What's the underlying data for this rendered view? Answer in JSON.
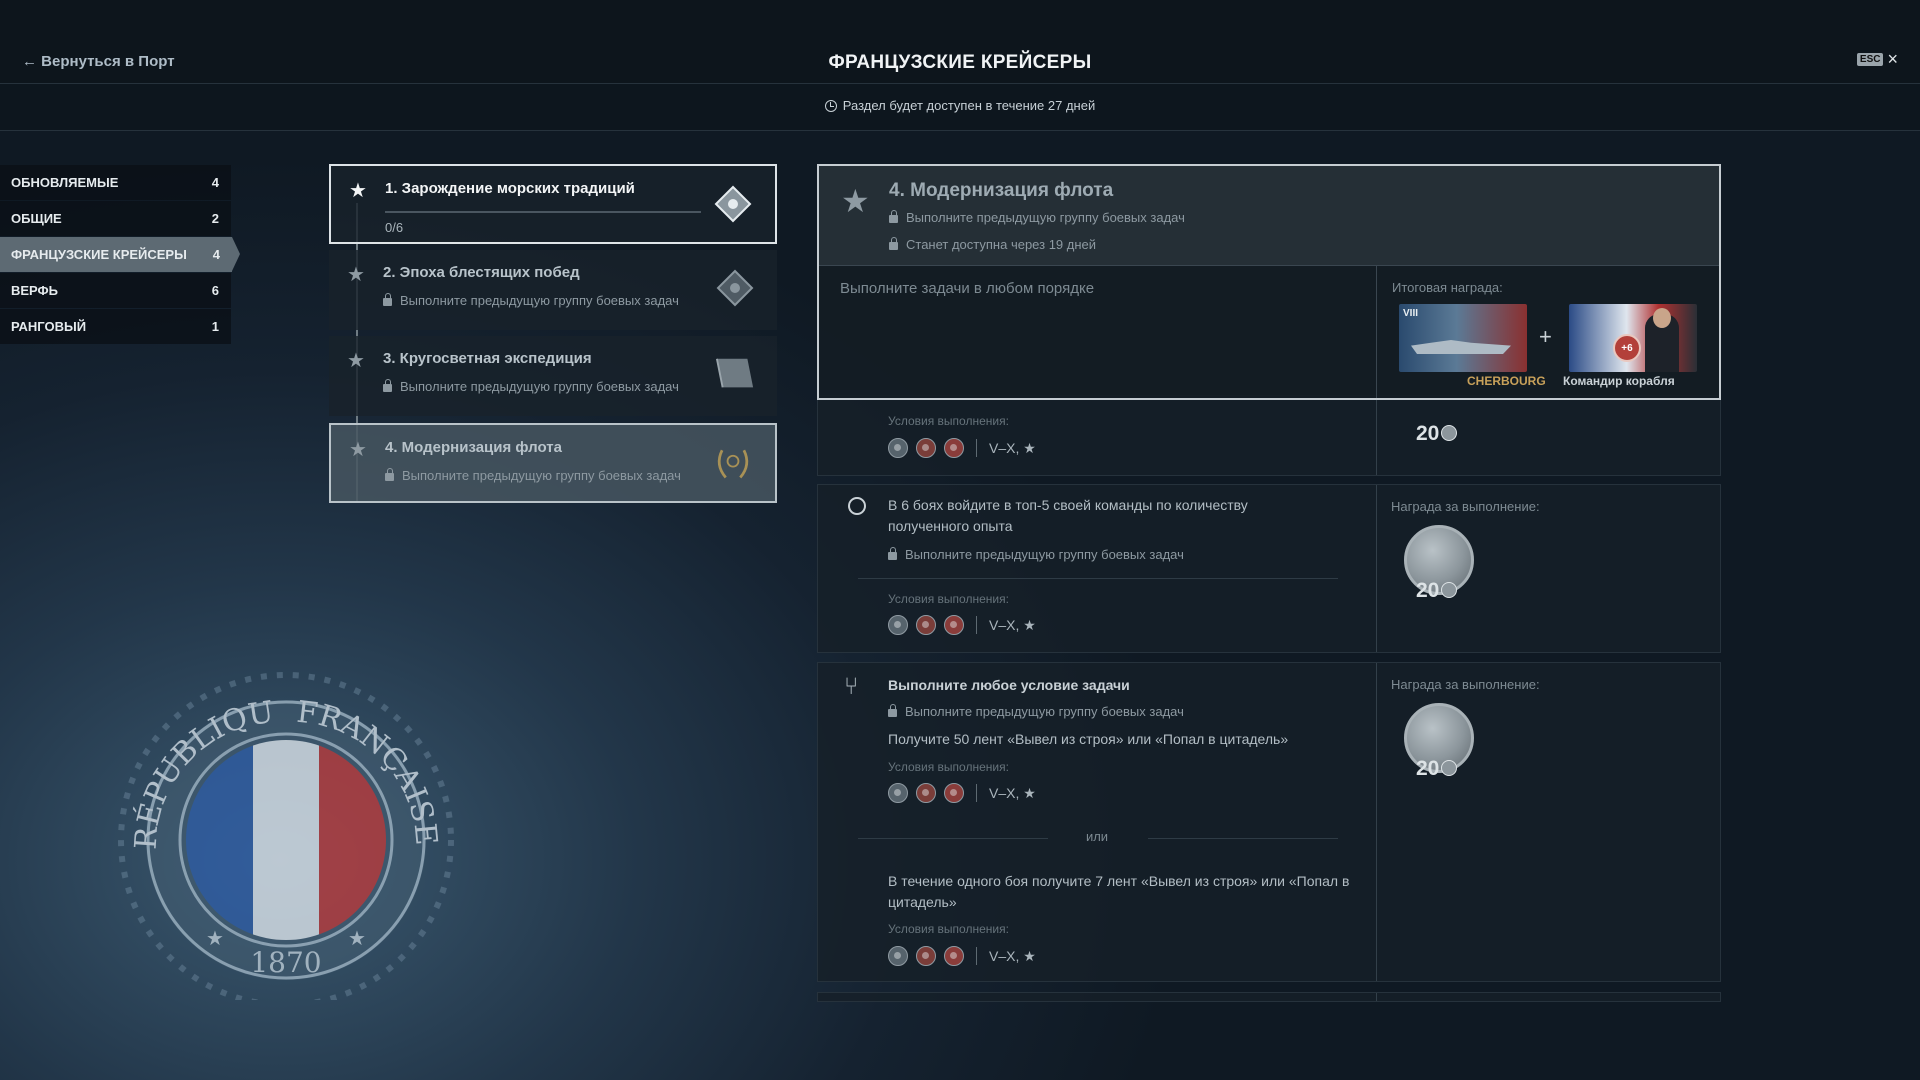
{
  "header": {
    "back_label": "← Вернуться в Порт",
    "title": "ФРАНЦУЗСКИЕ КРЕЙСЕРЫ",
    "esc_label": "ESC",
    "close_icon": "×"
  },
  "availability": "Раздел будет доступен в течение 27 дней",
  "sidebar": {
    "items": [
      {
        "label": "ОБНОВЛЯЕМЫЕ",
        "count": "4"
      },
      {
        "label": "ОБЩИЕ",
        "count": "2"
      },
      {
        "label": "ФРАНЦУЗСКИЕ КРЕЙСЕРЫ",
        "count": "4"
      },
      {
        "label": "ВЕРФЬ",
        "count": "6"
      },
      {
        "label": "РАНГОВЫЙ",
        "count": "1"
      }
    ]
  },
  "groups": [
    {
      "title": "1. Зарождение морских традиций",
      "progress_text": "0/6",
      "progress_fraction": 0
    },
    {
      "title": "2. Эпоха блестящих побед",
      "lock_text": "Выполните предыдущую группу боевых задач"
    },
    {
      "title": "3. Кругосветная экспедиция",
      "lock_text": "Выполните предыдущую группу боевых задач"
    },
    {
      "title": "4. Модернизация флота",
      "lock_text": "Выполните предыдущую группу боевых задач"
    }
  ],
  "panel": {
    "title": "4. Модернизация флота",
    "lock1": "Выполните предыдущую группу боевых задач",
    "lock2": "Станет доступна через 19 дней",
    "order_text": "Выполните задачи в любом порядке",
    "final_reward_label": "Итоговая награда:",
    "ship_tier": "VIII",
    "ship_name": "CHERBOURG",
    "plus": "+",
    "commander_skill": "+6",
    "commander_label": "Командир корабля"
  },
  "tasks": {
    "conditions_label": "Условия выполнения:",
    "tiers": "V–X, ★",
    "reward_label": "Награда за выполнение:",
    "reward_amount": "20",
    "task1_text": "В 6 боях войдите в топ-5 своей команды по количеству полученного опыта",
    "lock_text": "Выполните предыдущую группу боевых задач",
    "task2_title": "Выполните любое условие задачи",
    "task2_text1": "Получите 50 лент «Вывел из строя» или «Попал в цитадель»",
    "or_label": "или",
    "task2_text2": "В течение одного боя получите 7 лент «Вывел из строя» или «Попал в цитадель»"
  },
  "emblem": {
    "text_top_left": "RÉPUBLIQUE",
    "text_top_right": "FRANÇAISE",
    "year": "1870"
  },
  "colors": {
    "accent": "#dde3e7",
    "flag_blue": "#2f5ea8",
    "flag_red": "#c23a3a"
  }
}
